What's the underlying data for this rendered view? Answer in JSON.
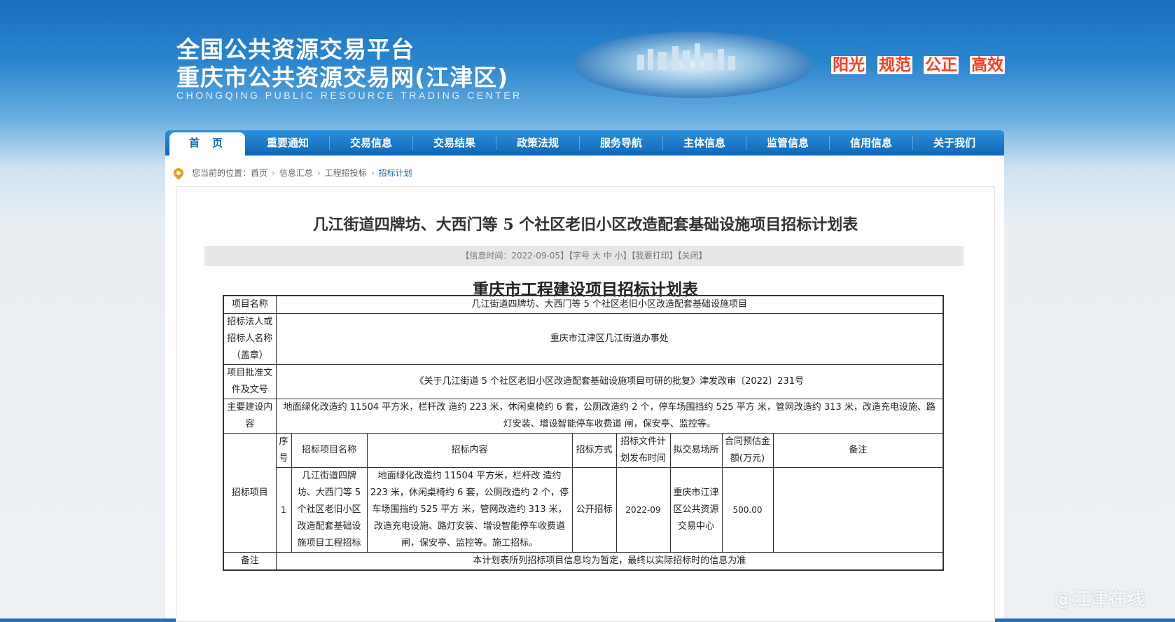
{
  "header": {
    "title_line1": "全国公共资源交易平台",
    "title_line2": "重庆市公共资源交易网(江津区)",
    "subtitle": "CHONGQING PUBLIC RESOURCE TRADING CENTER",
    "slogans": [
      "阳光",
      "规范",
      "公正",
      "高效"
    ]
  },
  "nav": {
    "items": [
      "首页",
      "重要通知",
      "交易信息",
      "交易结果",
      "政策法规",
      "服务导航",
      "主体信息",
      "监管信息",
      "信用信息",
      "关于我们"
    ]
  },
  "breadcrumb": {
    "prefix": "您当前的位置：",
    "items": [
      "首页",
      "信息汇总",
      "工程招投标",
      "招标计划"
    ]
  },
  "article": {
    "title": "几江街道四牌坊、大西门等 5 个社区老旧小区改造配套基础设施项目招标计划表",
    "info": {
      "time": "【信息时间：2022-09-05】",
      "font_label": "【字号",
      "big": "大",
      "mid": "中",
      "small": "小】",
      "print": "【我要打印】",
      "close": "【关闭】"
    },
    "doc_title": "重庆市工程建设项目招标计划表"
  },
  "table": {
    "project_name_label": "项目名称",
    "project_name": "几江街道四牌坊、大西门等 5 个社区老旧小区改造配套基础设施项目",
    "tenderer_label": "招标法人或招标人名称（盖章）",
    "tenderer": "重庆市江津区几江街道办事处",
    "approval_label": "项目批准文件及文号",
    "approval": "《关于几江街道 5 个社区老旧小区改造配套基础设施项目可研的批复》津发改审〔2022〕231号",
    "main_content_label": "主要建设内容",
    "main_content": "地面绿化改造约 11504 平方米，栏杆改 造约 223 米，休闲桌椅约 6 套，公厕改造约 2 个，停车场围挡约 525 平方 米，管网改造约 313 米，改造充电设施、路灯安装、增设智能停车收费道 闸，保安亭、监控等。",
    "items_label": "招标项目",
    "headers": [
      "序号",
      "招标项目名称",
      "招标内容",
      "招标方式",
      "招标文件计划发布时间",
      "拟交易场所",
      "合同预估金额(万元)",
      "备注"
    ],
    "rows": [
      {
        "no": "1",
        "name": "几江街道四牌坊、大西门等 5 个社区老旧小区改造配套基础设施项目工程招标",
        "content": "地面绿化改造约 11504 平方米，栏杆改 造约 223 米，休闲桌椅约 6 套，公厕改造约 2 个，停车场围挡约 525 平方 米，管网改造约 313 米，改造充电设施、路灯安装、增设智能停车收费道 闸，保安亭、监控等。施工招标。",
        "method": "公开招标",
        "publish_time": "2022-09",
        "venue": "重庆市江津区公共资源交易中心",
        "amount": "500.00",
        "remark": ""
      }
    ],
    "remark_label": "备注",
    "remark": "本计划表所列招标项目信息均为暂定，最终以实际招标时的信息为准"
  },
  "watermark": "@江津在线"
}
